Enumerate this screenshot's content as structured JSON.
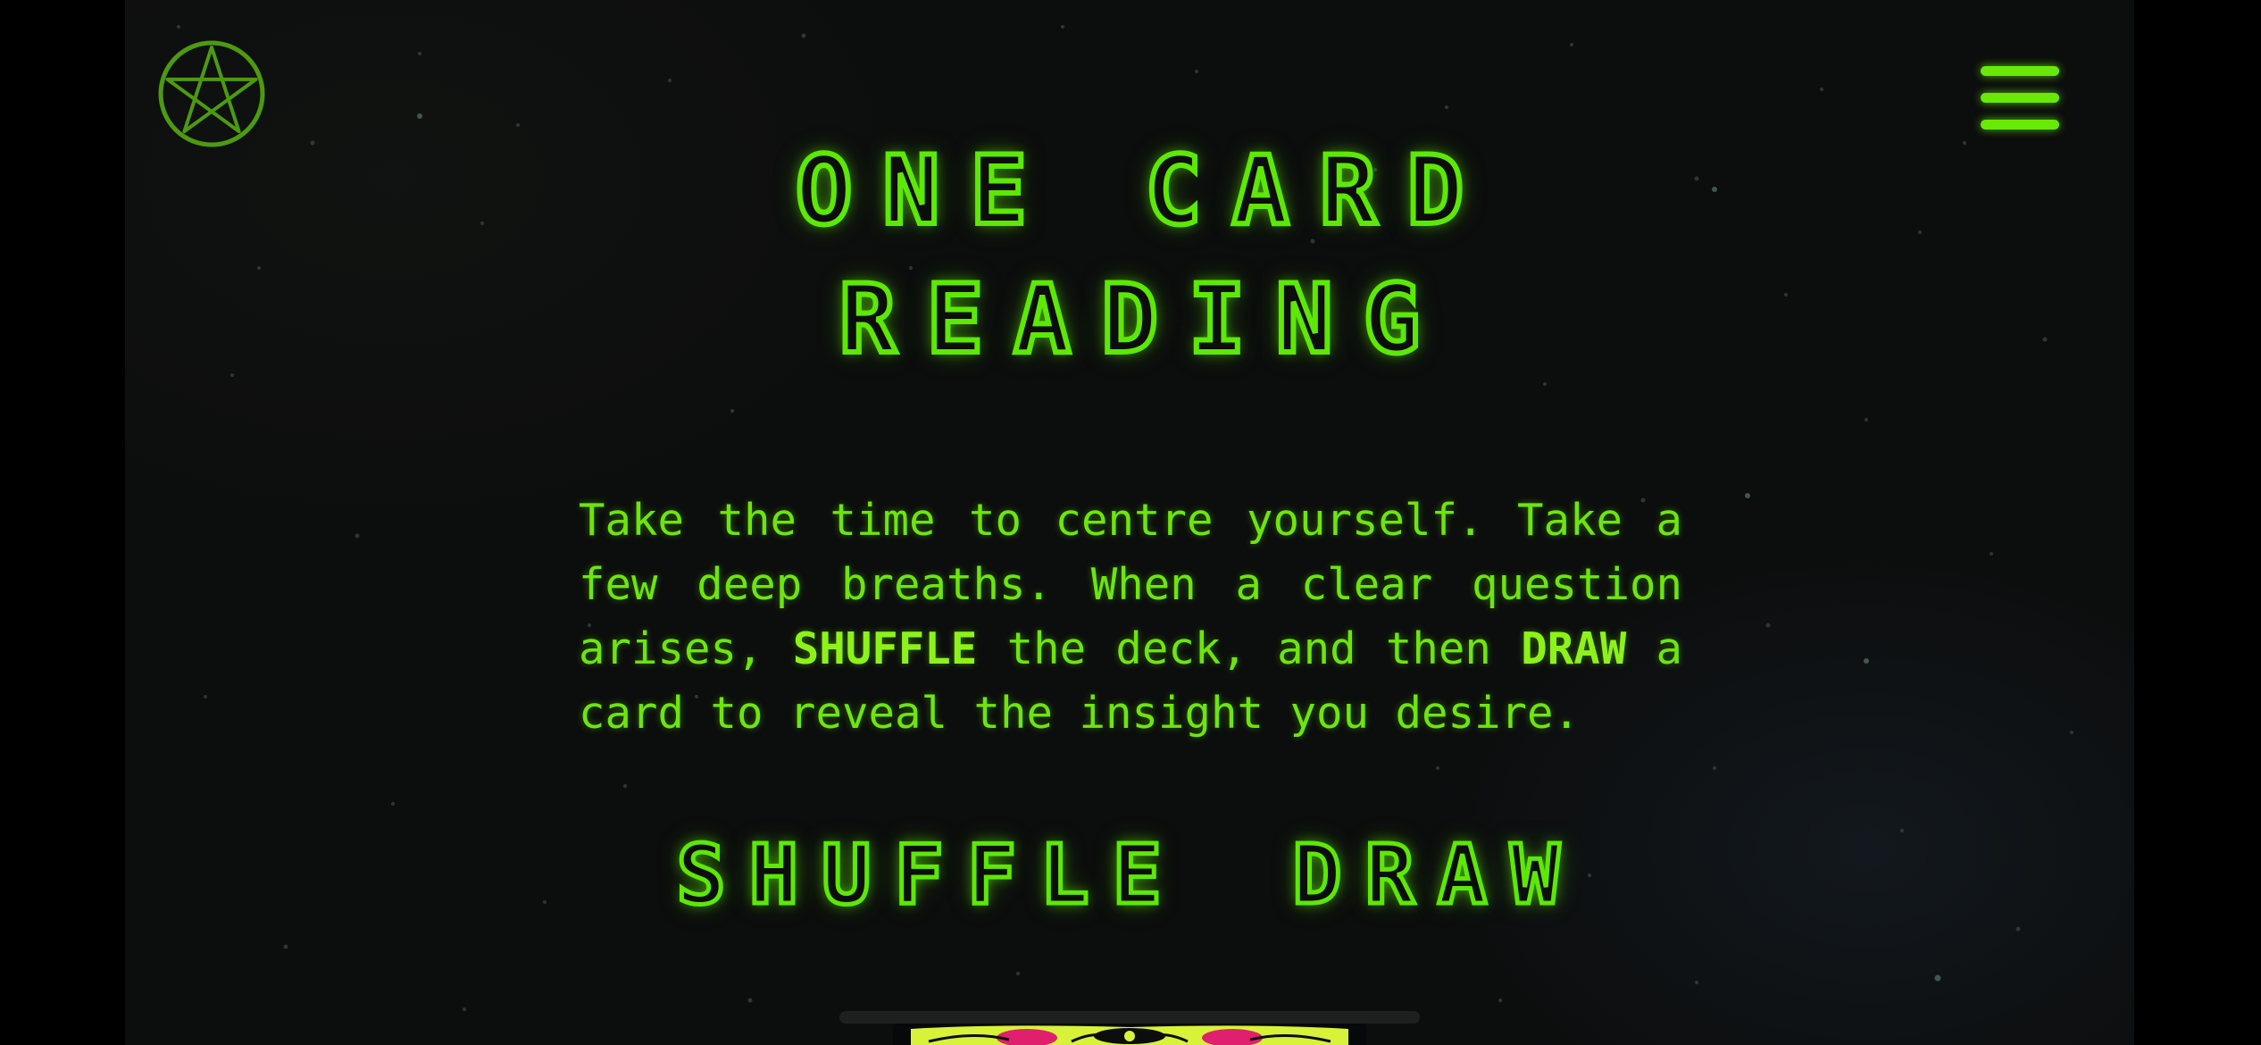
{
  "page": {
    "title_lines": [
      "ONE CARD",
      "READING"
    ]
  },
  "header": {
    "logo_icon": "pentacle-icon",
    "menu_icon": "hamburger-menu-icon"
  },
  "intro": {
    "part1": "Take the time to centre yourself. Take a few deep breaths. When a clear question arises, ",
    "keyword1": "SHUFFLE",
    "part2": " the deck, and then ",
    "keyword2": "DRAW",
    "part3": " a card to reveal the insight you desire."
  },
  "actions": {
    "shuffle_label": "SHUFFLE",
    "draw_label": "DRAW"
  },
  "colors": {
    "accent": "#5de806",
    "text": "#6fe40e",
    "background": "#0c0d0d",
    "card_pink": "#e0206e",
    "card_yellow": "#d8f23a"
  }
}
